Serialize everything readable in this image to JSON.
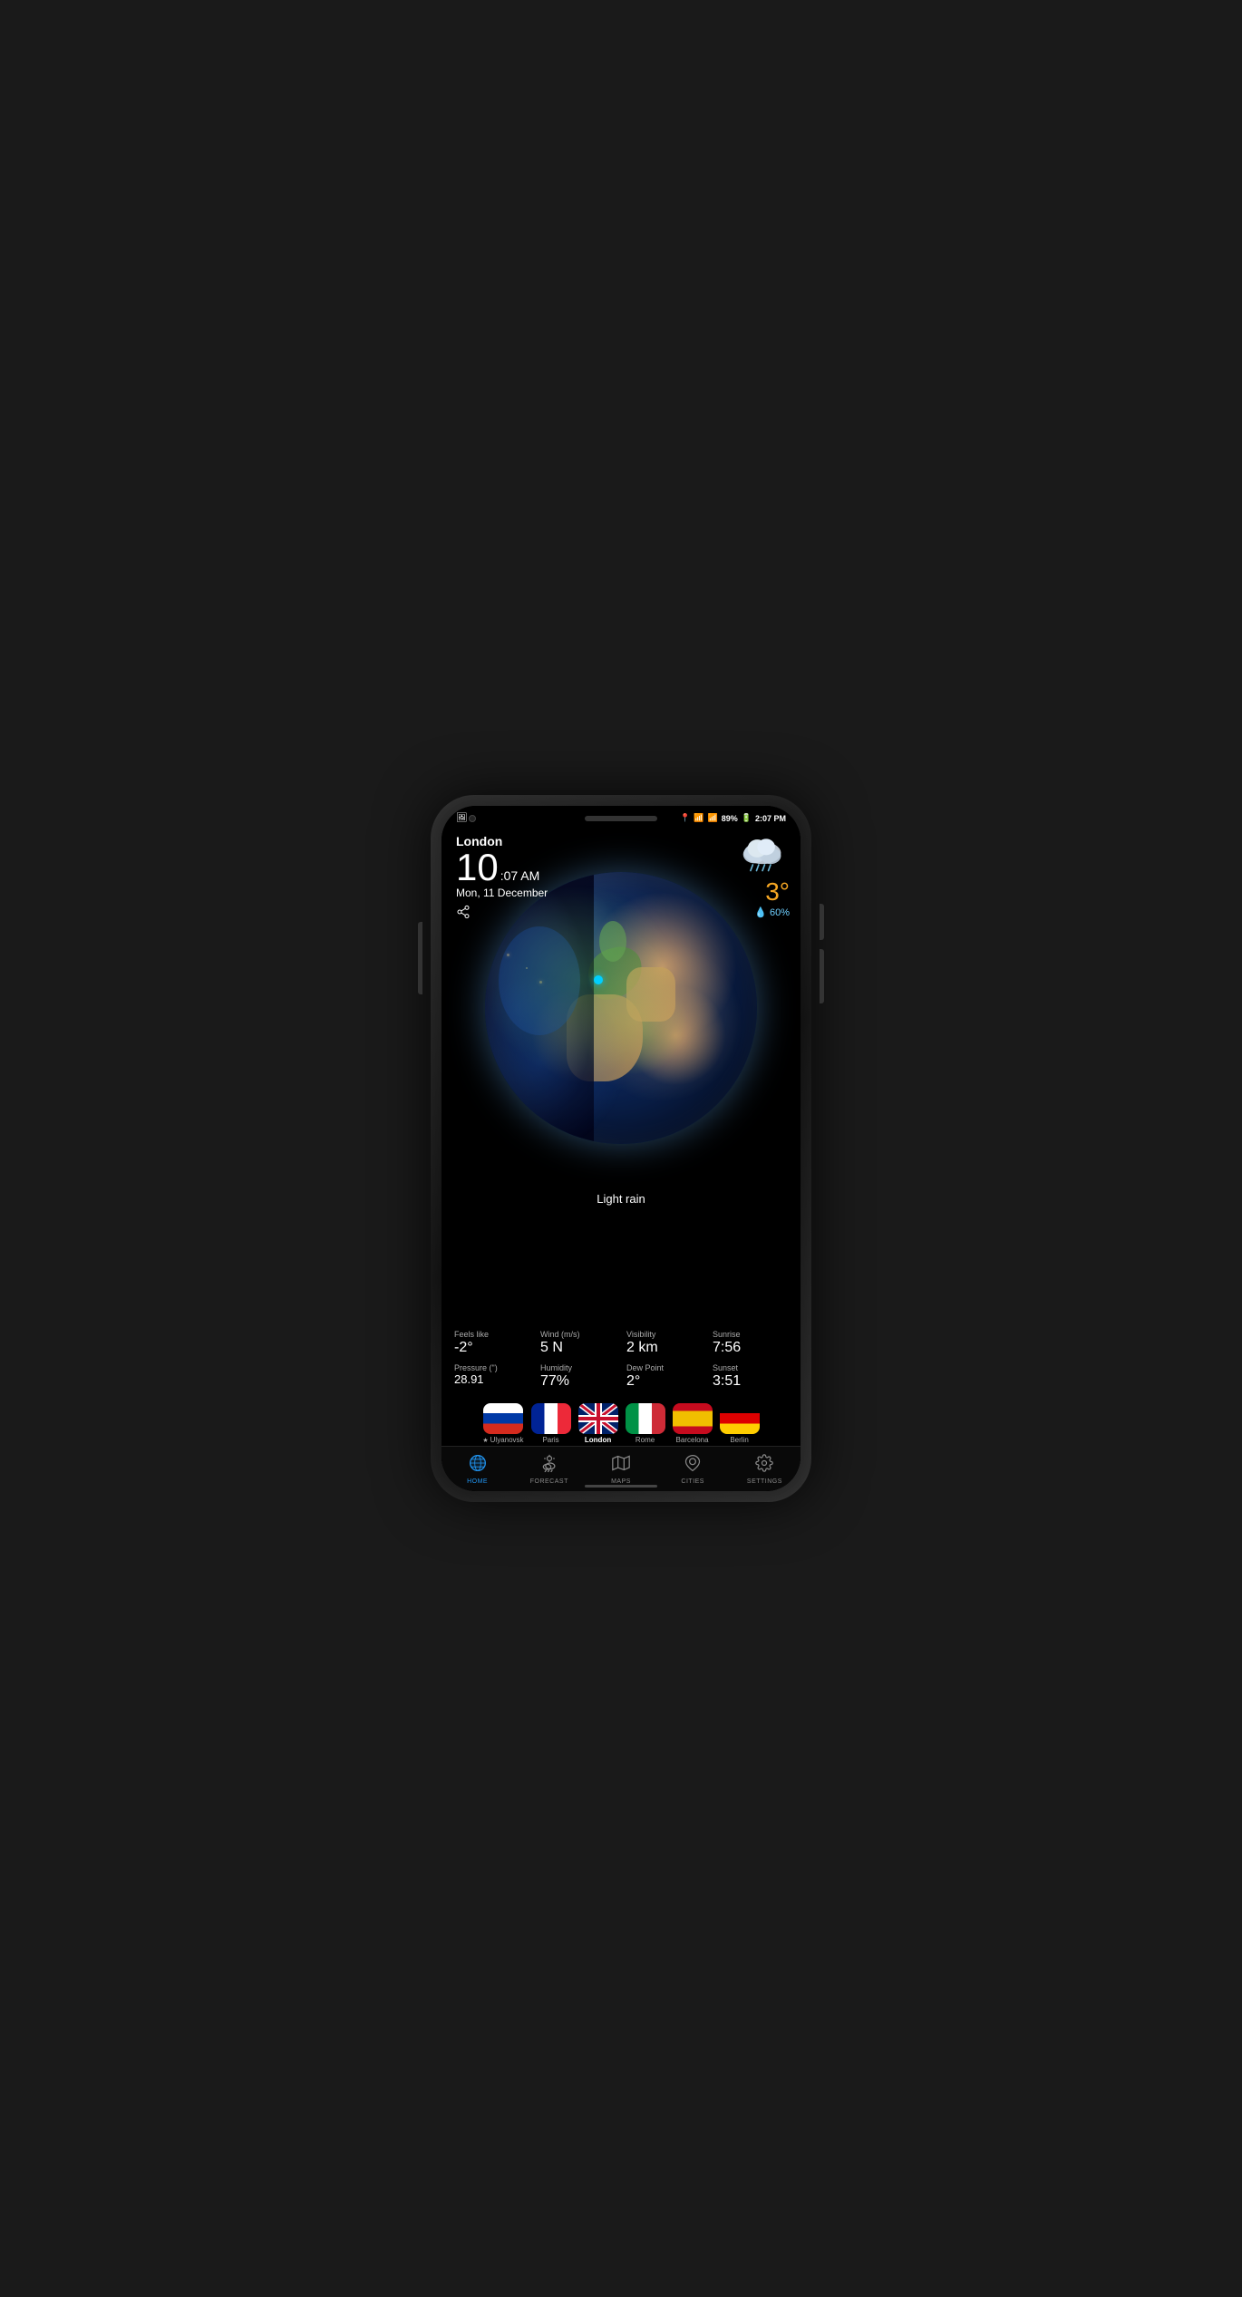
{
  "phone": {
    "statusBar": {
      "locationIcon": "📍",
      "wifiIcon": "wifi",
      "signalIcon": "signal",
      "battery": "89%",
      "time": "2:07 PM"
    },
    "header": {
      "imageIcon": "🖼",
      "city": "London",
      "hour": "10",
      "timeSuffix": ":07 AM",
      "date": "Mon, 11 December",
      "shareIcon": "share"
    },
    "weather": {
      "temperature": "3°",
      "humidity": "💧 60%",
      "condition": "Light rain",
      "feelsLikeLabel": "Feels like",
      "feelsLikeValue": "-2°",
      "windLabel": "Wind (m/s)",
      "windValue": "5 N",
      "visibilityLabel": "Visibility",
      "visibilityValue": "2 km",
      "sunriseLabel": "Sunrise",
      "sunriseValue": "7:56",
      "pressureLabel": "Pressure (\")",
      "pressureValue": "28.91",
      "humidityLabel": "Humidity",
      "humidityValue": "77%",
      "dewPointLabel": "Dew Point",
      "dewPointValue": "2°",
      "sunsetLabel": "Sunset",
      "sunsetValue": "3:51"
    },
    "cities": [
      {
        "name": "Ulyanovsk",
        "flag": "ru",
        "active": false,
        "starred": true
      },
      {
        "name": "Paris",
        "flag": "fr",
        "active": false,
        "starred": false
      },
      {
        "name": "London",
        "flag": "uk",
        "active": true,
        "starred": false
      },
      {
        "name": "Rome",
        "flag": "it",
        "active": false,
        "starred": false
      },
      {
        "name": "Barcelona",
        "flag": "es",
        "active": false,
        "starred": false
      },
      {
        "name": "Berlin",
        "flag": "de",
        "active": false,
        "starred": false
      }
    ],
    "nav": [
      {
        "id": "home",
        "label": "HOME",
        "icon": "🌐",
        "active": true
      },
      {
        "id": "forecast",
        "label": "FORECAST",
        "icon": "⛅",
        "active": false
      },
      {
        "id": "maps",
        "label": "MAPS",
        "icon": "🗺",
        "active": false
      },
      {
        "id": "cities",
        "label": "CITIES",
        "icon": "📍",
        "active": false
      },
      {
        "id": "settings",
        "label": "SETTINGS",
        "icon": "⚙",
        "active": false
      }
    ]
  }
}
